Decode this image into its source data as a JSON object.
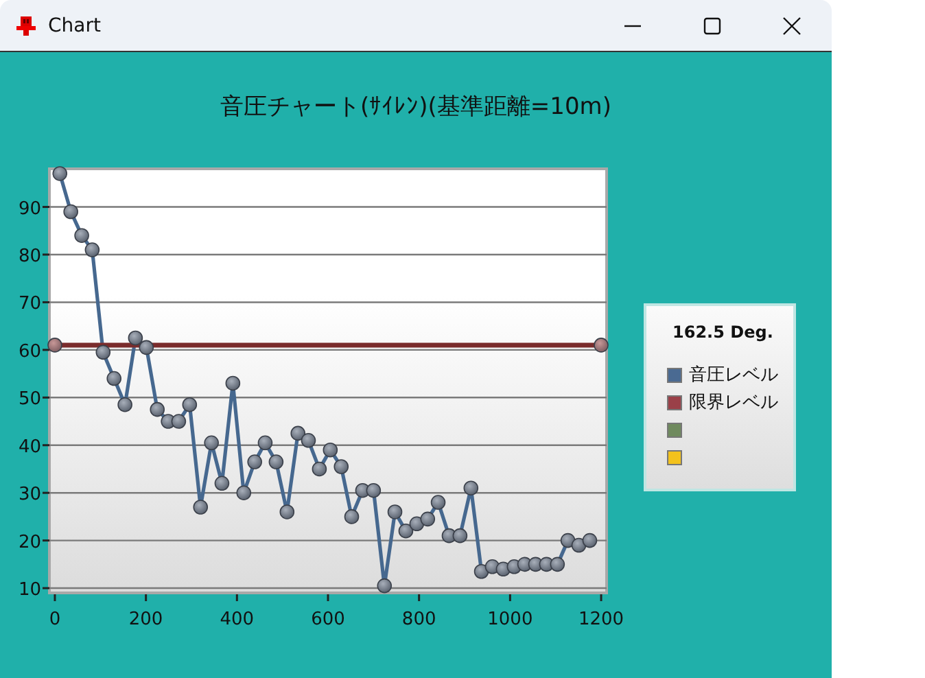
{
  "window": {
    "title": "Chart"
  },
  "chart": {
    "title": "音圧チャート(ｻｲﾚﾝ)(基準距離=10m)",
    "chart_data": {
      "type": "line",
      "grid": true,
      "xlim": [
        -12,
        1212
      ],
      "ylim": [
        9,
        98
      ],
      "xticks": [
        0,
        200,
        400,
        600,
        800,
        1000,
        1200
      ],
      "yticks": [
        10,
        20,
        30,
        40,
        50,
        60,
        70,
        80,
        90
      ],
      "series": [
        {
          "name": "音圧レベル",
          "color": "#46688f",
          "marker": true,
          "x": [
            11,
            35,
            59,
            82,
            106,
            130,
            154,
            177,
            201,
            225,
            249,
            272,
            296,
            320,
            344,
            367,
            391,
            415,
            439,
            462,
            486,
            510,
            534,
            557,
            581,
            605,
            629,
            652,
            676,
            700,
            724,
            747,
            771,
            795,
            819,
            842,
            866,
            890,
            914,
            937,
            961,
            985,
            1009,
            1032,
            1056,
            1080,
            1104,
            1127,
            1151,
            1175
          ],
          "values": [
            97,
            89,
            84,
            81,
            59.5,
            54,
            48.5,
            62.5,
            60.5,
            47.5,
            45,
            45,
            48.5,
            27,
            40.5,
            32,
            53,
            30,
            36.5,
            40.5,
            36.5,
            26,
            42.5,
            41,
            35,
            39,
            35.5,
            25,
            30.5,
            30.5,
            10.5,
            26,
            22,
            23.5,
            24.5,
            28,
            21,
            21,
            31,
            13.5,
            14.5,
            14,
            14.5,
            15,
            15,
            15,
            15,
            20,
            19,
            20
          ]
        },
        {
          "name": "限界レベル",
          "color": "#7a2c2c",
          "marker": true,
          "x": [
            0,
            1200
          ],
          "values": [
            61,
            61
          ]
        }
      ]
    },
    "legend": {
      "title": "162.5 Deg.",
      "items": [
        {
          "color": "#4a6a92"
        },
        {
          "color": "#9a4048"
        },
        {
          "color": "#6f8a5e"
        },
        {
          "color": "#f3c21c"
        }
      ]
    }
  }
}
